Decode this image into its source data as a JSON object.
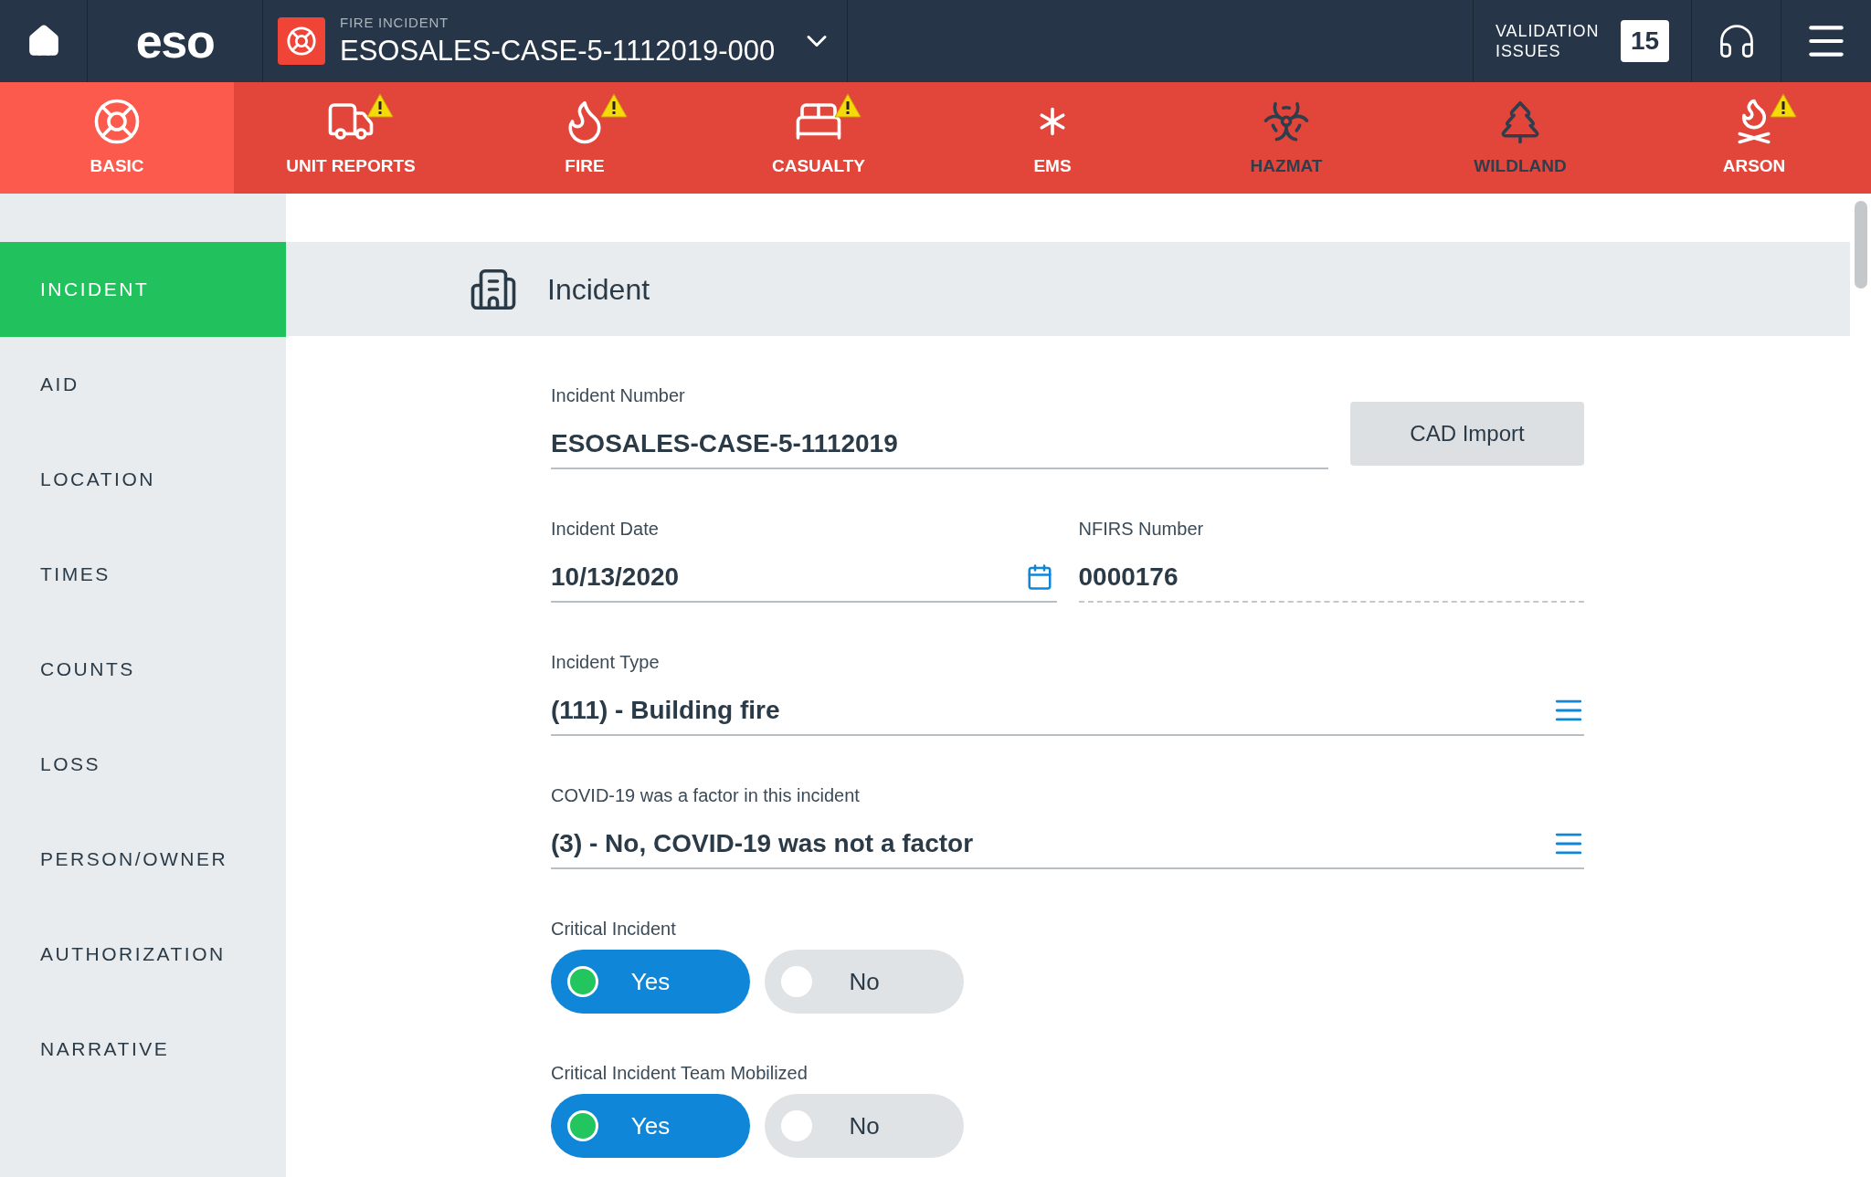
{
  "header": {
    "logo": "eso",
    "record_type": "FIRE INCIDENT",
    "record_title": "ESOSALES-CASE-5-1112019-000",
    "validation_label": "VALIDATION ISSUES",
    "validation_count": "15"
  },
  "modules": [
    {
      "kind": "basic",
      "label": "BASIC",
      "selected": true,
      "complete": true,
      "warning": false
    },
    {
      "kind": "unit",
      "label": "UNIT REPORTS",
      "selected": false,
      "complete": true,
      "warning": true
    },
    {
      "kind": "fire",
      "label": "FIRE",
      "selected": false,
      "complete": true,
      "warning": true
    },
    {
      "kind": "casualty",
      "label": "CASUALTY",
      "selected": false,
      "complete": true,
      "warning": true
    },
    {
      "kind": "ems",
      "label": "EMS",
      "selected": false,
      "complete": true,
      "warning": false
    },
    {
      "kind": "hazmat",
      "label": "HAZMAT",
      "selected": false,
      "complete": false,
      "warning": false
    },
    {
      "kind": "wildland",
      "label": "WILDLAND",
      "selected": false,
      "complete": false,
      "warning": false
    },
    {
      "kind": "arson",
      "label": "ARSON",
      "selected": false,
      "complete": true,
      "warning": true
    }
  ],
  "sidebar": {
    "items": [
      {
        "label": "INCIDENT",
        "selected": true
      },
      {
        "label": "AID",
        "selected": false
      },
      {
        "label": "LOCATION",
        "selected": false
      },
      {
        "label": "TIMES",
        "selected": false
      },
      {
        "label": "COUNTS",
        "selected": false
      },
      {
        "label": "LOSS",
        "selected": false
      },
      {
        "label": "PERSON/OWNER",
        "selected": false
      },
      {
        "label": "AUTHORIZATION",
        "selected": false
      },
      {
        "label": "NARRATIVE",
        "selected": false
      }
    ]
  },
  "section": {
    "title": "Incident"
  },
  "form": {
    "incident_number": {
      "label": "Incident Number",
      "value": "ESOSALES-CASE-5-1112019"
    },
    "cad_import": "CAD Import",
    "incident_date": {
      "label": "Incident Date",
      "value": "10/13/2020"
    },
    "nfirs_number": {
      "label": "NFIRS Number",
      "value": "0000176"
    },
    "incident_type": {
      "label": "Incident Type",
      "value": "(111) - Building fire"
    },
    "covid": {
      "label": "COVID-19 was a factor in this incident",
      "value": "(3) - No, COVID-19 was not a factor"
    },
    "toggles": [
      {
        "label": "Critical Incident",
        "options": [
          {
            "label": "Yes",
            "selected": true
          },
          {
            "label": "No",
            "selected": false
          }
        ]
      },
      {
        "label": "Critical Incident Team Mobilized",
        "options": [
          {
            "label": "Yes",
            "selected": true
          },
          {
            "label": "No",
            "selected": false
          }
        ]
      }
    ]
  }
}
